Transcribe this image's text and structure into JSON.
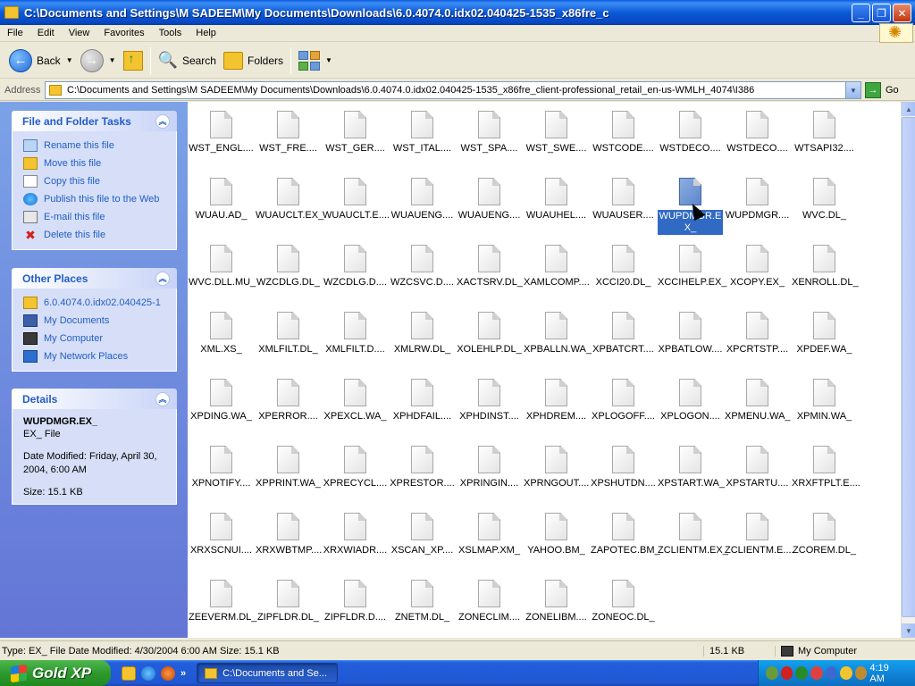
{
  "window": {
    "title": "C:\\Documents and Settings\\M SADEEM\\My Documents\\Downloads\\6.0.4074.0.idx02.040425-1535_x86fre_c",
    "min": "_",
    "max": "❐",
    "close": "✕"
  },
  "menu": [
    "File",
    "Edit",
    "View",
    "Favorites",
    "Tools",
    "Help"
  ],
  "toolbar": {
    "back": "Back",
    "search": "Search",
    "folders": "Folders"
  },
  "address": {
    "label": "Address",
    "value": "C:\\Documents and Settings\\M SADEEM\\My Documents\\Downloads\\6.0.4074.0.idx02.040425-1535_x86fre_client-professional_retail_en-us-WMLH_4074\\I386",
    "go": "Go"
  },
  "tasks": {
    "title": "File and Folder Tasks",
    "items": [
      "Rename this file",
      "Move this file",
      "Copy this file",
      "Publish this file to the Web",
      "E-mail this file",
      "Delete this file"
    ]
  },
  "places": {
    "title": "Other Places",
    "items": [
      "6.0.4074.0.idx02.040425-1",
      "My Documents",
      "My Computer",
      "My Network Places"
    ]
  },
  "details": {
    "title": "Details",
    "name": "WUPDMGR.EX_",
    "type": "EX_ File",
    "modified_1": "Date Modified: Friday, April 30,",
    "modified_2": "2004, 6:00 AM",
    "size": "Size: 15.1 KB"
  },
  "files": [
    "WST_ENGL....",
    "WST_FRE....",
    "WST_GER....",
    "WST_ITAL....",
    "WST_SPA....",
    "WST_SWE....",
    "WSTCODE....",
    "WSTDECO....",
    "WSTDECO....",
    "WTSAPI32....",
    "WUAU.AD_",
    "WUAUCLT.EX_",
    "WUAUCLT.E....",
    "WUAUENG....",
    "WUAUENG....",
    "WUAUHEL....",
    "WUAUSER....",
    "WUPDMGR.EX_",
    "WUPDMGR....",
    "WVC.DL_",
    "WVC.DLL.MU_",
    "WZCDLG.DL_",
    "WZCDLG.D....",
    "WZCSVC.D....",
    "XACTSRV.DL_",
    "XAMLCOMP....",
    "XCCI20.DL_",
    "XCCIHELP.EX_",
    "XCOPY.EX_",
    "XENROLL.DL_",
    "XML.XS_",
    "XMLFILT.DL_",
    "XMLFILT.D....",
    "XMLRW.DL_",
    "XOLEHLP.DL_",
    "XPBALLN.WA_",
    "XPBATCRT....",
    "XPBATLOW....",
    "XPCRTSTP....",
    "XPDEF.WA_",
    "XPDING.WA_",
    "XPERROR....",
    "XPEXCL.WA_",
    "XPHDFAIL....",
    "XPHDINST....",
    "XPHDREM....",
    "XPLOGOFF....",
    "XPLOGON....",
    "XPMENU.WA_",
    "XPMIN.WA_",
    "XPNOTIFY....",
    "XPPRINT.WA_",
    "XPRECYCL....",
    "XPRESTOR....",
    "XPRINGIN....",
    "XPRNGOUT....",
    "XPSHUTDN....",
    "XPSTART.WA_",
    "XPSTARTU....",
    "XRXFTPLT.E....",
    "XRXSCNUI....",
    "XRXWBTMP....",
    "XRXWIADR....",
    "XSCAN_XP....",
    "XSLMAP.XM_",
    "YAHOO.BM_",
    "ZAPOTEC.BM_",
    "ZCLIENTM.EX_",
    "ZCLIENTM.E....",
    "ZCOREM.DL_",
    "ZEEVERM.DL_",
    "ZIPFLDR.DL_",
    "ZIPFLDR.D....",
    "ZNETM.DL_",
    "ZONECLIM....",
    "ZONELIBM....",
    "ZONEOC.DL_"
  ],
  "selected_index": 17,
  "status": {
    "info": "Type: EX_ File Date Modified: 4/30/2004 6:00 AM Size: 15.1 KB",
    "size": "15.1 KB",
    "zone": "My Computer"
  },
  "taskbar": {
    "start": "Gold XP",
    "more": "»",
    "window": "C:\\Documents and Se...",
    "clock": "4:19 AM"
  },
  "colors": {
    "selection": "#316ac5",
    "task_link": "#215dc6",
    "title_blue": "#0b5ad6",
    "start_green": "#2e9a2e"
  }
}
